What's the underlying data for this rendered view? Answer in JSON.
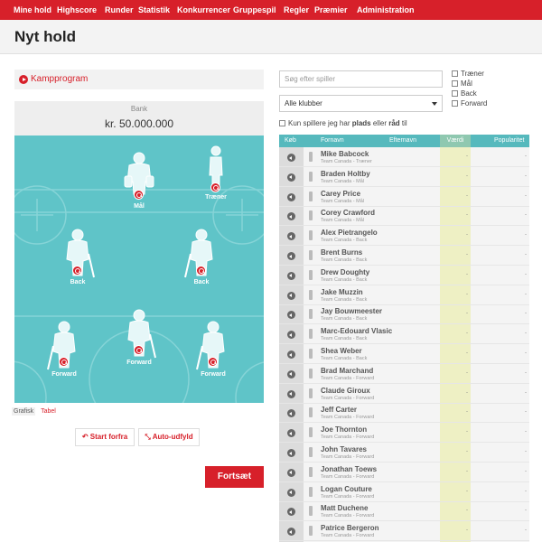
{
  "nav": {
    "items": [
      "Mine hold",
      "Highscore",
      "Runder",
      "Statistik",
      "Konkurrencer",
      "Gruppespil",
      "Regler",
      "Præmier",
      "Administration"
    ]
  },
  "page_title": "Nyt hold",
  "kampprogram": {
    "label": "Kampprogram"
  },
  "bank": {
    "label": "Bank",
    "value": "kr. 50.000.000"
  },
  "rink": {
    "labels": {
      "goalie": "Mål",
      "coach": "Træner",
      "back": "Back",
      "forward": "Forward"
    }
  },
  "view_links": {
    "grafisk": "Grafisk",
    "tabel": "Tabel"
  },
  "buttons": {
    "start_forfra": "Start forfra",
    "auto_udfyld": "Auto-udfyld",
    "fortsaet": "Fortsæt"
  },
  "filters": {
    "search_placeholder": "Søg efter spiller",
    "club_select": "Alle klubber",
    "roles": [
      "Træner",
      "Mål",
      "Back",
      "Forward"
    ],
    "kun_text_1": "Kun spillere jeg har",
    "kun_bold_1": "plads",
    "kun_text_2": "eller",
    "kun_bold_2": "råd",
    "kun_text_3": "til"
  },
  "table": {
    "headers": {
      "kob": "Køb",
      "fornavn": "Fornavn",
      "efternavn": "Efternavn",
      "vaerdi": "Værdi",
      "popularitet": "Popularitet"
    },
    "rows": [
      {
        "name": "Mike Babcock",
        "sub": "Team Canada - Træner",
        "value": "-",
        "pop": "-"
      },
      {
        "name": "Braden Holtby",
        "sub": "Team Canada - Mål",
        "value": "-",
        "pop": "-"
      },
      {
        "name": "Carey Price",
        "sub": "Team Canada - Mål",
        "value": "-",
        "pop": "-"
      },
      {
        "name": "Corey Crawford",
        "sub": "Team Canada - Mål",
        "value": "-",
        "pop": "-"
      },
      {
        "name": "Alex Pietrangelo",
        "sub": "Team Canada - Back",
        "value": "-",
        "pop": "-"
      },
      {
        "name": "Brent Burns",
        "sub": "Team Canada - Back",
        "value": "-",
        "pop": "-"
      },
      {
        "name": "Drew Doughty",
        "sub": "Team Canada - Back",
        "value": "-",
        "pop": "-"
      },
      {
        "name": "Jake Muzzin",
        "sub": "Team Canada - Back",
        "value": "-",
        "pop": "-"
      },
      {
        "name": "Jay Bouwmeester",
        "sub": "Team Canada - Back",
        "value": "-",
        "pop": "-"
      },
      {
        "name": "Marc-Edouard Vlasic",
        "sub": "Team Canada - Back",
        "value": "-",
        "pop": "-"
      },
      {
        "name": "Shea Weber",
        "sub": "Team Canada - Back",
        "value": "-",
        "pop": "-"
      },
      {
        "name": "Brad Marchand",
        "sub": "Team Canada - Forward",
        "value": "-",
        "pop": "-"
      },
      {
        "name": "Claude Giroux",
        "sub": "Team Canada - Forward",
        "value": "-",
        "pop": "-"
      },
      {
        "name": "Jeff Carter",
        "sub": "Team Canada - Forward",
        "value": "-",
        "pop": "-"
      },
      {
        "name": "Joe Thornton",
        "sub": "Team Canada - Forward",
        "value": "-",
        "pop": "-"
      },
      {
        "name": "John Tavares",
        "sub": "Team Canada - Forward",
        "value": "-",
        "pop": "-"
      },
      {
        "name": "Jonathan Toews",
        "sub": "Team Canada - Forward",
        "value": "-",
        "pop": "-"
      },
      {
        "name": "Logan Couture",
        "sub": "Team Canada - Forward",
        "value": "-",
        "pop": "-"
      },
      {
        "name": "Matt Duchene",
        "sub": "Team Canada - Forward",
        "value": "-",
        "pop": "-"
      },
      {
        "name": "Patrice Bergeron",
        "sub": "Team Canada - Forward",
        "value": "-",
        "pop": "-"
      }
    ]
  },
  "colors": {
    "brand_red": "#d7202a",
    "rink": "#5fc4c8",
    "table_head": "#56b9bd",
    "value_col": "#eef0c4"
  }
}
